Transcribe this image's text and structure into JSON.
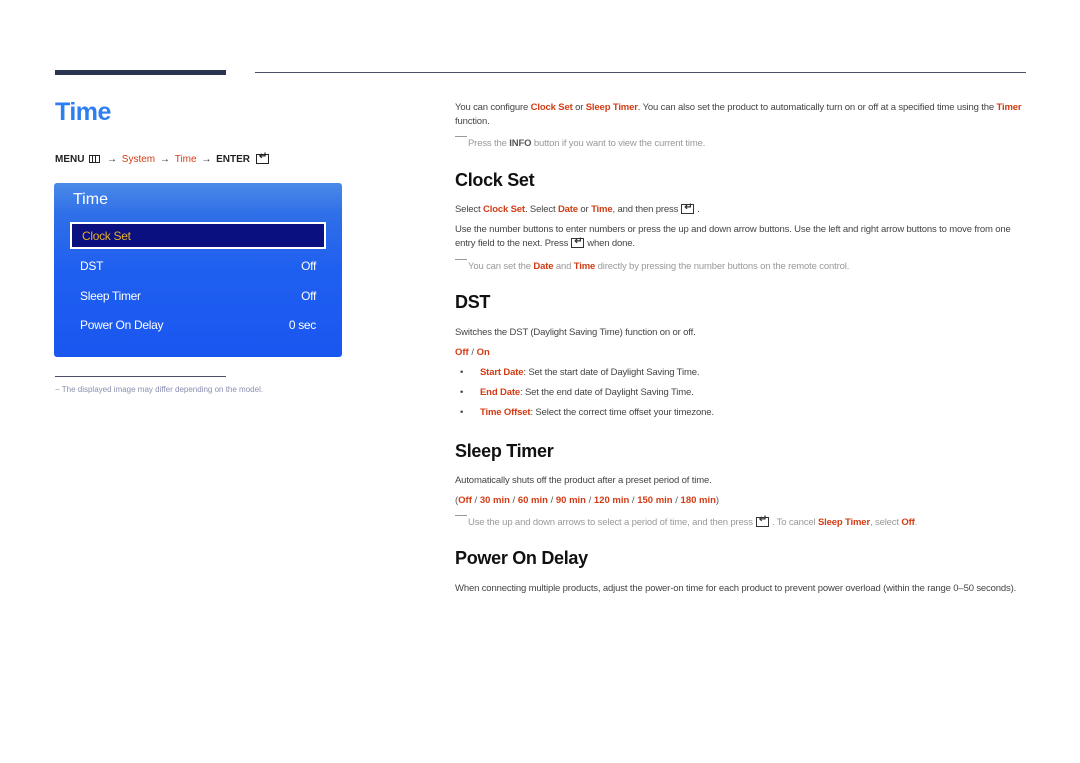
{
  "page": {
    "title": "Time",
    "menu_path": {
      "menu": "MENU",
      "menu_icon": "menu-icon",
      "arrow": "→",
      "system": "System",
      "time": "Time",
      "enter": "ENTER",
      "enter_icon": "enter-icon"
    }
  },
  "osd": {
    "title": "Time",
    "items": [
      {
        "label": "Clock Set",
        "value": "",
        "selected": true
      },
      {
        "label": "DST",
        "value": "Off"
      },
      {
        "label": "Sleep Timer",
        "value": "Off"
      },
      {
        "label": "Power On Delay",
        "value": "0 sec"
      }
    ]
  },
  "footnote": "−  The displayed image may differ depending on the model.",
  "intro": {
    "t1": "You can configure ",
    "clock_set": "Clock Set",
    "t2": " or ",
    "sleep_timer": "Sleep Timer",
    "t3": ". You can also set the product to automatically turn on or off at a specified time using the ",
    "timer": "Timer",
    "t4": " function.",
    "note_t1": "Press the ",
    "note_info": "INFO",
    "note_t2": " button if you want to view the current time."
  },
  "clock_set": {
    "heading": "Clock Set",
    "p1_t1": "Select ",
    "p1_clock_set": "Clock Set",
    "p1_t2": ". Select ",
    "p1_date": "Date",
    "p1_t3": " or ",
    "p1_time": "Time",
    "p1_t4": ", and then press",
    "p1_t5": ".",
    "p2_t1": "Use the number buttons to enter numbers or press the up and down arrow buttons. Use the left and right arrow buttons to move from one entry field to the next. Press",
    "p2_t2": "when done.",
    "note_t1": "You can set the ",
    "note_date": "Date",
    "note_t2": " and ",
    "note_time": "Time",
    "note_t3": " directly by pressing the number buttons on the remote control."
  },
  "dst": {
    "heading": "DST",
    "desc": "Switches the DST (Daylight Saving Time) function on or off.",
    "opt_off": "Off",
    "opt_sep": " / ",
    "opt_on": "On",
    "bullets": [
      {
        "term": "Start Date",
        "text": ": Set the start date of Daylight Saving Time."
      },
      {
        "term": "End Date",
        "text": ": Set the end date of Daylight Saving Time."
      },
      {
        "term": "Time Offset",
        "text": ": Select the correct time offset your timezone."
      }
    ],
    "bullet_char": "•"
  },
  "sleep_timer": {
    "heading": "Sleep Timer",
    "desc": "Automatically shuts off the product after a preset period of time.",
    "options": [
      "Off",
      "30 min",
      "60 min",
      "90 min",
      "120 min",
      "150 min",
      "180 min"
    ],
    "open": "(",
    "close": ")",
    "sep": " / ",
    "note_t1": "Use the up and down arrows to select a period of time, and then press",
    "note_t2": ". To cancel ",
    "note_sleep": "Sleep Timer",
    "note_t3": ", select ",
    "note_off": "Off",
    "note_t4": "."
  },
  "power_on_delay": {
    "heading": "Power On Delay",
    "desc": "When connecting multiple products, adjust the power-on time for each product to prevent power overload (within the range 0–50 seconds)."
  }
}
